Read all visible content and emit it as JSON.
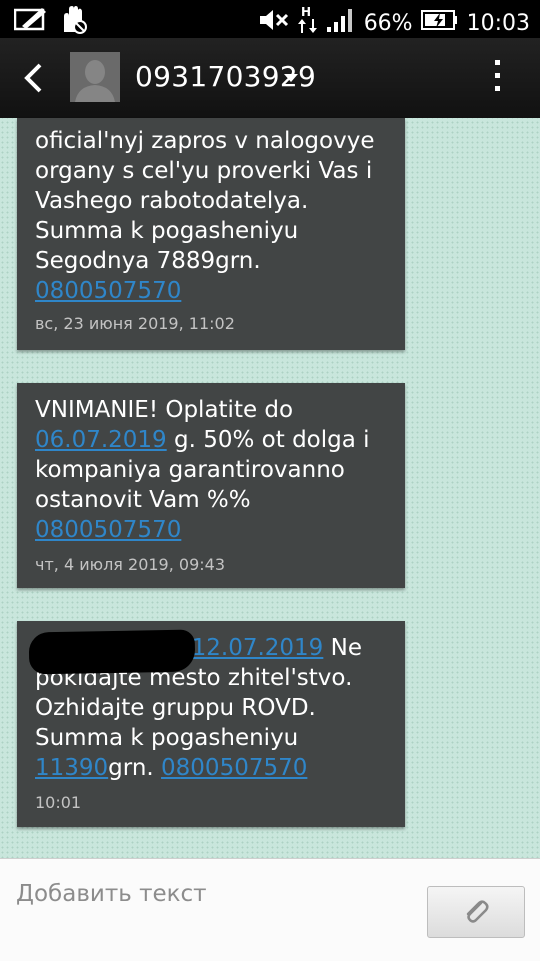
{
  "status_bar": {
    "battery_percent": "66%",
    "time": "10:03",
    "icons": [
      "edit-icon",
      "touch-icon",
      "mute-icon",
      "data-h-icon",
      "signal-icon",
      "battery-charging-icon"
    ]
  },
  "header": {
    "contact": "0931703929",
    "icons": [
      "back-arrow-icon",
      "avatar",
      "dropdown-caret-icon",
      "overflow-menu-icon"
    ]
  },
  "messages": [
    {
      "text_top_cut": "oficial'nyj zapros v nalogovye organy s cel'yu proverki Vas i Vashego rabotodatelya. Summa k pogasheniyu Segodnya 7889grn.",
      "line1": "oficial'nyj zapros v nalogovye",
      "line2": "organy s cel'yu proverki Vas i",
      "line3": "Vashego rabotodatelya.",
      "line4": "Summa k pogasheniyu",
      "line5": "Segodnya 7889grn.",
      "phone": "0800507570",
      "time": "вс, 23 июня 2019, 11:02"
    },
    {
      "line1": "VNIMANIE! Oplatite do",
      "date_link": "06.07.2019",
      "line2_rest": " g. 50% ot dolga i",
      "line3": "kompaniya garantirovanno",
      "line4": "ostanovit Vam %%",
      "phone": "0800507570",
      "time": "чт, 4 июля 2019, 09:43"
    },
    {
      "line1_prefix": ", ",
      "date_link": "12.07.2019",
      "line1_rest": " Ne",
      "line2": "pokidajte mesto zhitel'stvo.",
      "line3": "Ozhidajte gruppu ROVD.",
      "line4": "Summa k pogasheniyu",
      "amount_link": "11390",
      "amount_suffix": "grn. ",
      "phone": "0800507570",
      "time": "10:01"
    }
  ],
  "composer": {
    "placeholder": "Добавить текст",
    "attach_icon": "paperclip-icon"
  },
  "colors": {
    "bubble": "#424545",
    "link": "#2f86c9",
    "header": "#1a1a1a",
    "background": "#c9e6dc"
  }
}
